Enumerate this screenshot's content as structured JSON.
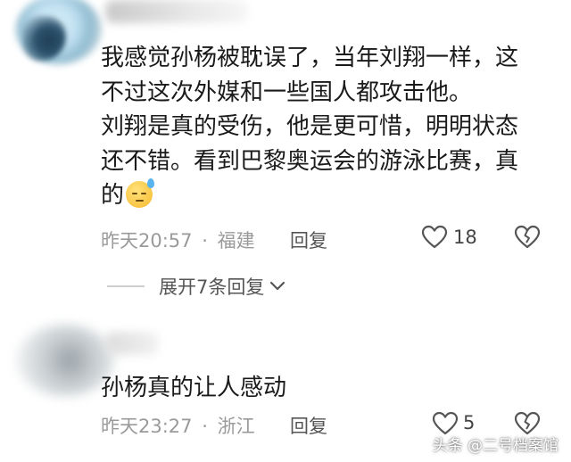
{
  "comments": [
    {
      "text_lines": [
        "我感觉孙杨被耽误了，当年刘翔一样，这",
        "不过这次外媒和一些国人都攻击他。",
        "刘翔是真的受伤，他是更可惜，明明状态",
        "还不错。看到巴黎奥运会的游泳比赛，真",
        "的"
      ],
      "emoji": "sweat-smile-emoji",
      "time": "昨天20:57",
      "separator": "·",
      "location": "福建",
      "reply_label": "回复",
      "likes": "18",
      "expand_label": "展开7条回复"
    },
    {
      "text": "孙杨真的让人感动",
      "time": "昨天23:27",
      "separator": "·",
      "location": "浙江",
      "reply_label": "回复",
      "likes": "5"
    }
  ],
  "watermark": "头条 @二号档案馆",
  "icons": {
    "like": "heart-outline-icon",
    "dislike": "broken-heart-icon",
    "expand": "chevron-down-icon"
  },
  "colors": {
    "text": "#1a1a1a",
    "meta": "#9a9a9a",
    "action": "#555555"
  }
}
